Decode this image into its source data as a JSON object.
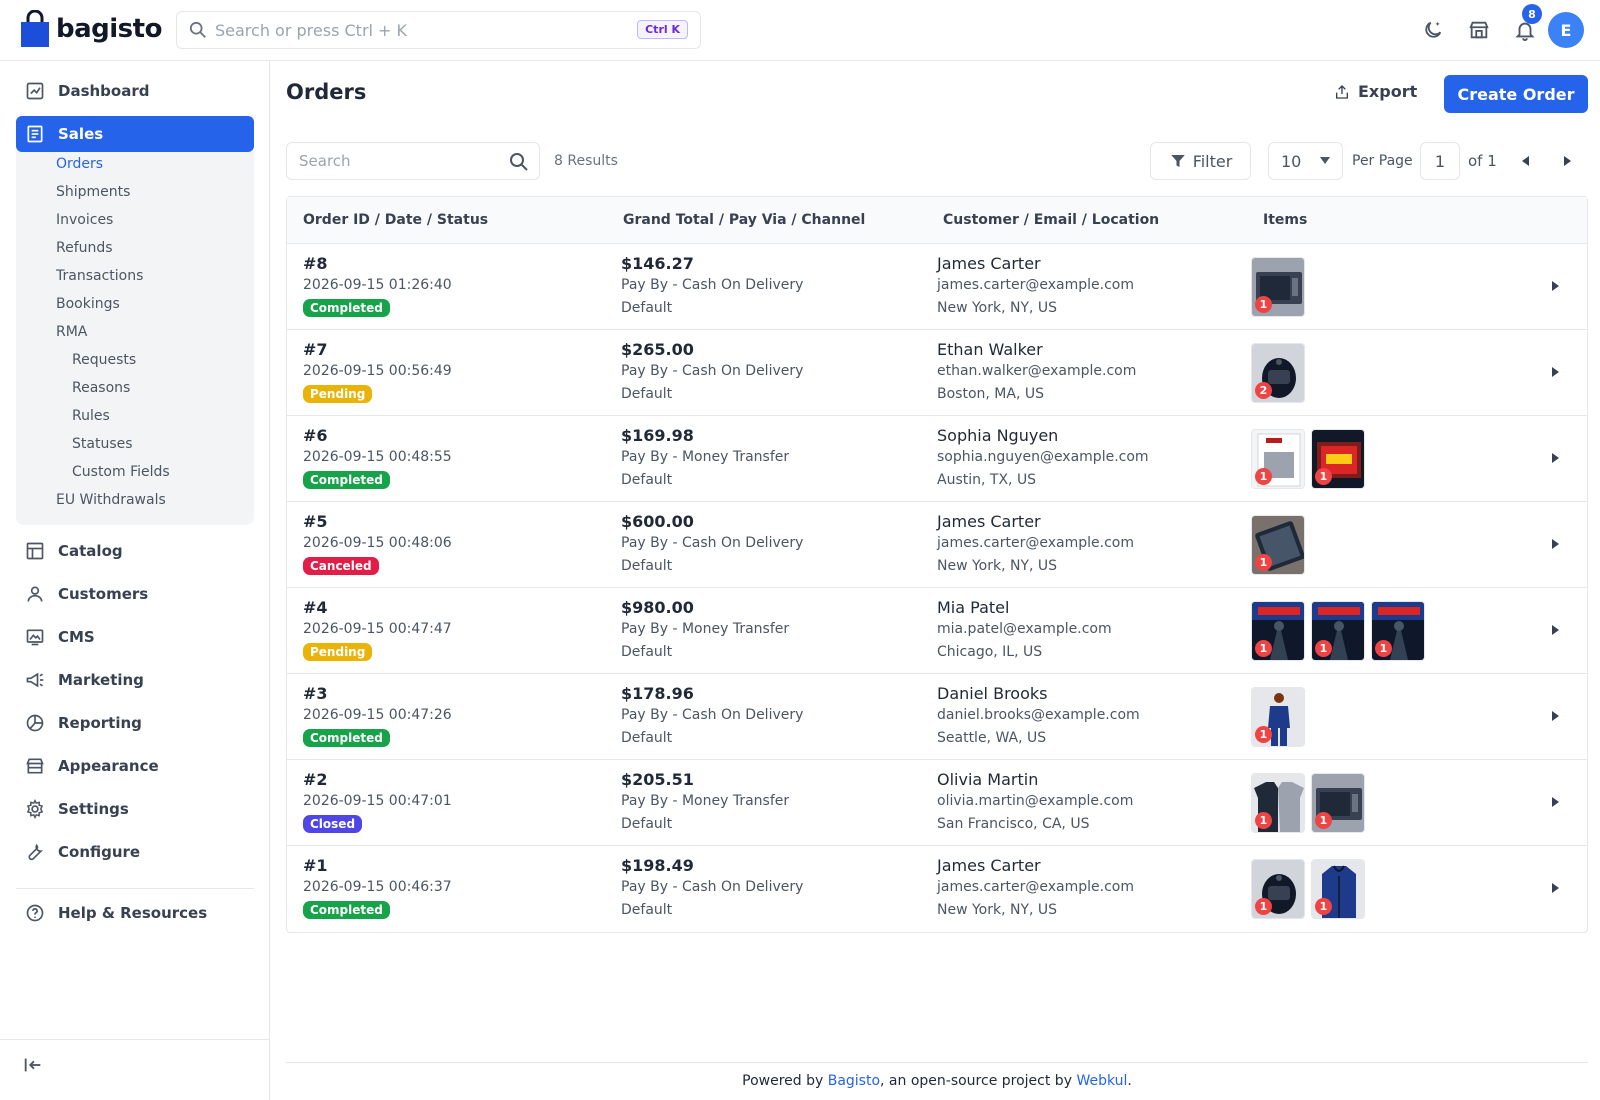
{
  "header": {
    "brand": "bagisto",
    "search_placeholder": "Search or press Ctrl + K",
    "shortcut": "Ctrl K",
    "notification_count": "8",
    "avatar_initial": "E",
    "icons": [
      "moon-icon",
      "store-icon",
      "bell-icon"
    ]
  },
  "sidebar": {
    "items": [
      {
        "label": "Dashboard",
        "icon": "dashboard-icon"
      },
      {
        "label": "Sales",
        "icon": "sales-icon"
      },
      {
        "label": "Catalog",
        "icon": "catalog-icon"
      },
      {
        "label": "Customers",
        "icon": "customers-icon"
      },
      {
        "label": "CMS",
        "icon": "cms-icon"
      },
      {
        "label": "Marketing",
        "icon": "marketing-icon"
      },
      {
        "label": "Reporting",
        "icon": "reporting-icon"
      },
      {
        "label": "Appearance",
        "icon": "appearance-icon"
      },
      {
        "label": "Settings",
        "icon": "settings-icon"
      },
      {
        "label": "Configure",
        "icon": "configure-icon"
      },
      {
        "label": "Help & Resources",
        "icon": "help-icon"
      }
    ],
    "sales_sub": [
      "Orders",
      "Shipments",
      "Invoices",
      "Refunds",
      "Transactions",
      "Bookings",
      "RMA"
    ],
    "rma_sub": [
      "Requests",
      "Reasons",
      "Rules",
      "Statuses",
      "Custom Fields"
    ],
    "eu_withdrawals": "EU Withdrawals"
  },
  "page": {
    "title": "Orders",
    "export_label": "Export",
    "create_label": "Create Order",
    "search_placeholder": "Search",
    "results": "8 Results",
    "filter_label": "Filter",
    "per_page_value": "10",
    "per_page_label": "Per Page",
    "page_number": "1",
    "page_of": "of 1"
  },
  "table": {
    "columns": [
      "Order ID / Date / Status",
      "Grand Total / Pay Via / Channel",
      "Customer / Email / Location",
      "Items"
    ],
    "rows": [
      {
        "id": "#8",
        "date": "2026-09-15 01:26:40",
        "status": "Completed",
        "total": "$146.27",
        "pay": "Pay By - Cash On Delivery",
        "channel": "Default",
        "name": "James Carter",
        "email": "james.carter@example.com",
        "location": "New York, NY, US",
        "items": [
          {
            "qty": "1",
            "kind": "microwave"
          }
        ]
      },
      {
        "id": "#7",
        "date": "2026-09-15 00:56:49",
        "status": "Pending",
        "total": "$265.00",
        "pay": "Pay By - Cash On Delivery",
        "channel": "Default",
        "name": "Ethan Walker",
        "email": "ethan.walker@example.com",
        "location": "Boston, MA, US",
        "items": [
          {
            "qty": "2",
            "kind": "airfryer"
          }
        ]
      },
      {
        "id": "#6",
        "date": "2026-09-15 00:48:55",
        "status": "Completed",
        "total": "$169.98",
        "pay": "Pay By - Money Transfer",
        "channel": "Default",
        "name": "Sophia Nguyen",
        "email": "sophia.nguyen@example.com",
        "location": "Austin, TX, US",
        "items": [
          {
            "qty": "1",
            "kind": "yoga-book"
          },
          {
            "qty": "1",
            "kind": "ticket"
          }
        ]
      },
      {
        "id": "#5",
        "date": "2026-09-15 00:48:06",
        "status": "Canceled",
        "total": "$600.00",
        "pay": "Pay By - Cash On Delivery",
        "channel": "Default",
        "name": "James Carter",
        "email": "james.carter@example.com",
        "location": "New York, NY, US",
        "items": [
          {
            "qty": "1",
            "kind": "tablet"
          }
        ]
      },
      {
        "id": "#4",
        "date": "2026-09-15 00:47:47",
        "status": "Pending",
        "total": "$980.00",
        "pay": "Pay By - Money Transfer",
        "channel": "Default",
        "name": "Mia Patel",
        "email": "mia.patel@example.com",
        "location": "Chicago, IL, US",
        "items": [
          {
            "qty": "1",
            "kind": "concert"
          },
          {
            "qty": "1",
            "kind": "concert"
          },
          {
            "qty": "1",
            "kind": "concert"
          }
        ]
      },
      {
        "id": "#3",
        "date": "2026-09-15 00:47:26",
        "status": "Completed",
        "total": "$178.96",
        "pay": "Pay By - Cash On Delivery",
        "channel": "Default",
        "name": "Daniel Brooks",
        "email": "daniel.brooks@example.com",
        "location": "Seattle, WA, US",
        "items": [
          {
            "qty": "1",
            "kind": "suit"
          }
        ]
      },
      {
        "id": "#2",
        "date": "2026-09-15 00:47:01",
        "status": "Closed",
        "total": "$205.51",
        "pay": "Pay By - Money Transfer",
        "channel": "Default",
        "name": "Olivia Martin",
        "email": "olivia.martin@example.com",
        "location": "San Francisco, CA, US",
        "items": [
          {
            "qty": "1",
            "kind": "tshirts"
          },
          {
            "qty": "1",
            "kind": "microwave"
          }
        ]
      },
      {
        "id": "#1",
        "date": "2026-09-15 00:46:37",
        "status": "Completed",
        "total": "$198.49",
        "pay": "Pay By - Cash On Delivery",
        "channel": "Default",
        "name": "James Carter",
        "email": "james.carter@example.com",
        "location": "New York, NY, US",
        "items": [
          {
            "qty": "1",
            "kind": "airfryer"
          },
          {
            "qty": "1",
            "kind": "hoodie"
          }
        ]
      }
    ]
  },
  "status_colors": {
    "Completed": "#16a34a",
    "Pending": "#eab308",
    "Canceled": "#e11d48",
    "Closed": "#4f46e5"
  },
  "footer": {
    "prefix": "Powered by ",
    "link1": "Bagisto",
    "middle": ", an open-source project by ",
    "link2": "Webkul",
    "suffix": "."
  }
}
